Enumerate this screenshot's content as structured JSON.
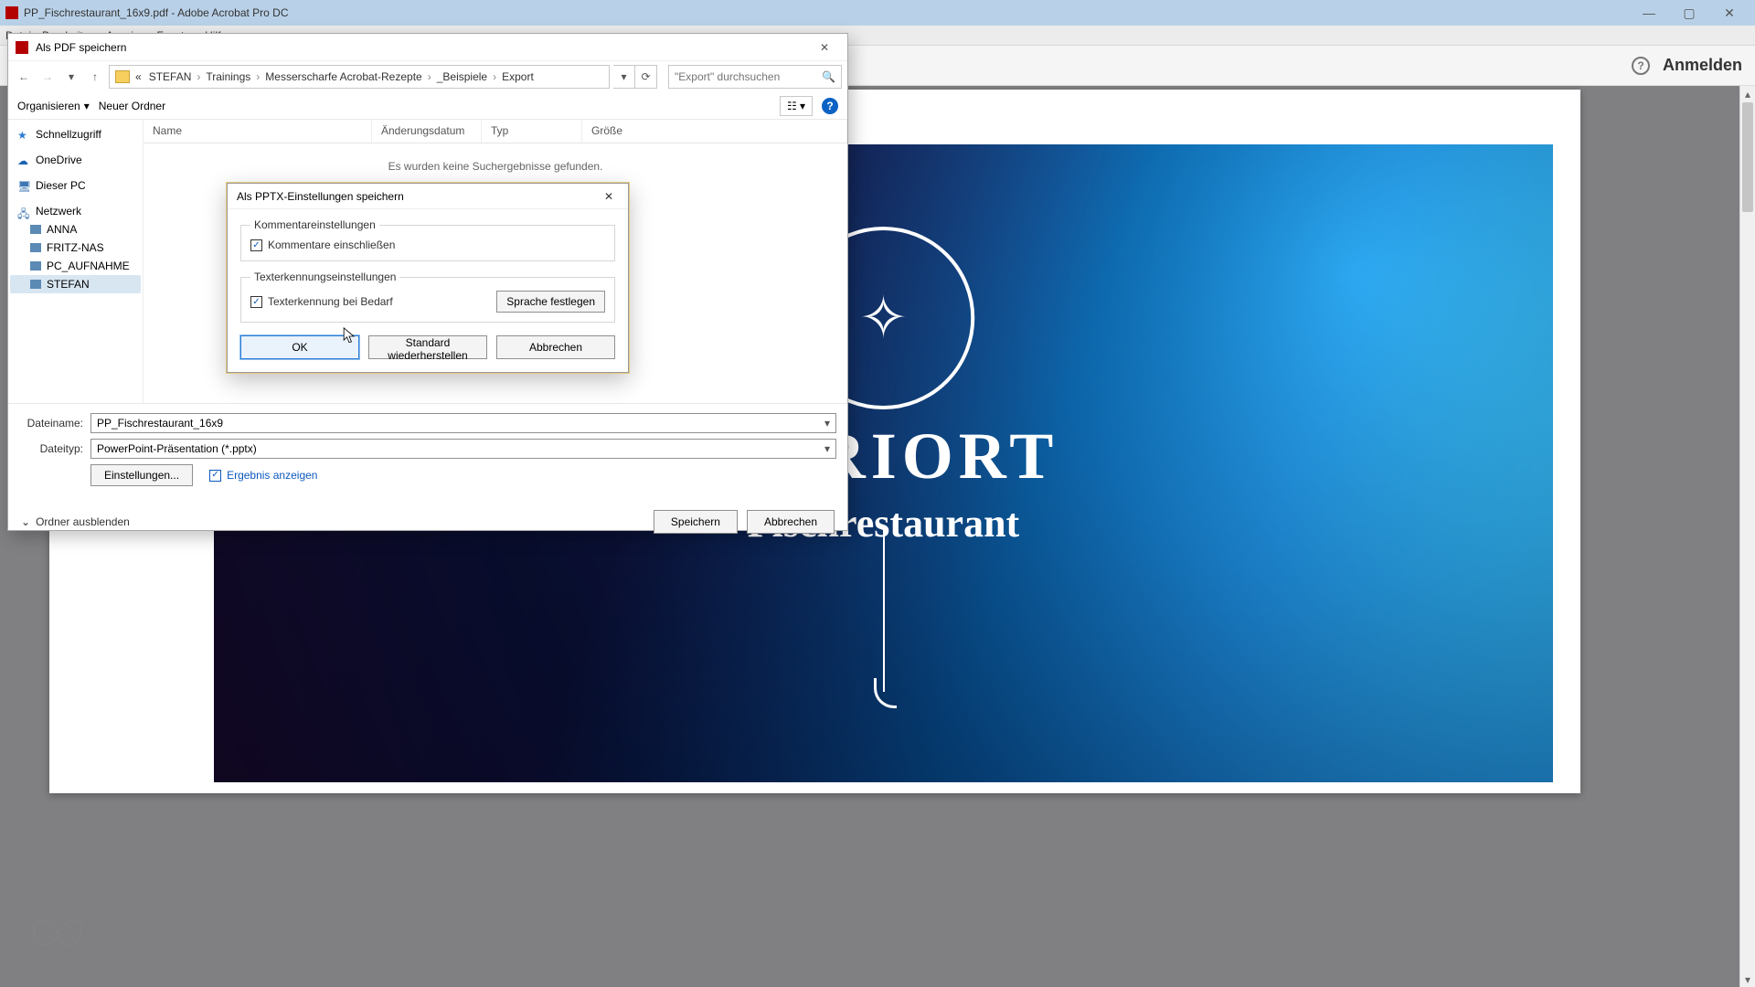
{
  "window": {
    "title": "PP_Fischrestaurant_16x9.pdf - Adobe Acrobat Pro DC"
  },
  "menu": {
    "items": [
      "Datei",
      "Bearbeiten",
      "Anzeige",
      "Fenster",
      "Hilfe"
    ]
  },
  "app": {
    "help_glyph": "?",
    "login": "Anmelden"
  },
  "doc": {
    "brand_top": "CORIORT",
    "brand_sub": "Fischrestaurant"
  },
  "save_dialog": {
    "title": "Als PDF speichern",
    "breadcrumb": {
      "prefix": "«",
      "items": [
        "STEFAN",
        "Trainings",
        "Messerscharfe Acrobat-Rezepte",
        "_Beispiele",
        "Export"
      ]
    },
    "search_placeholder": "\"Export\" durchsuchen",
    "organize": "Organisieren",
    "new_folder": "Neuer Ordner",
    "columns": {
      "name": "Name",
      "modified": "Änderungsdatum",
      "type": "Typ",
      "size": "Größe"
    },
    "empty": "Es wurden keine Suchergebnisse gefunden.",
    "tree": {
      "quick": "Schnellzugriff",
      "onedrive": "OneDrive",
      "thispc": "Dieser PC",
      "network": "Netzwerk",
      "nodes": [
        "ANNA",
        "FRITZ-NAS",
        "PC_AUFNAHME",
        "STEFAN"
      ]
    },
    "filename_label": "Dateiname:",
    "filename_value": "PP_Fischrestaurant_16x9",
    "filetype_label": "Dateityp:",
    "filetype_value": "PowerPoint-Präsentation (*.pptx)",
    "settings_btn": "Einstellungen...",
    "show_result": "Ergebnis anzeigen",
    "hide_folders": "Ordner ausblenden",
    "save": "Speichern",
    "cancel": "Abbrechen"
  },
  "pptx_dialog": {
    "title": "Als PPTX-Einstellungen speichern",
    "group1": "Kommentareinstellungen",
    "chk1": "Kommentare einschließen",
    "group2": "Texterkennungseinstellungen",
    "chk2": "Texterkennung bei Bedarf",
    "lang_btn": "Sprache festlegen",
    "ok": "OK",
    "restore": "Standard wiederherstellen",
    "cancel": "Abbrechen"
  }
}
